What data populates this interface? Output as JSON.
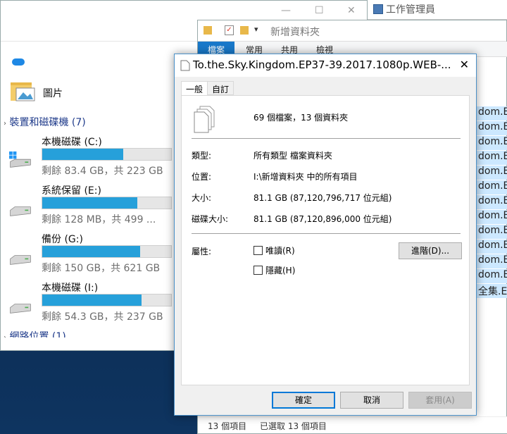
{
  "left_window": {
    "controls": [
      "—",
      "☐",
      "✕"
    ],
    "pictures_label": "圖片",
    "section_devices": "裝置和磁碟機 (7)",
    "drives": [
      {
        "name": "本機磁碟 (C:)",
        "free": "剩餘 83.4 GB，共 223 GB",
        "used_fraction": 0.63,
        "icon": "windows-drive-icon"
      },
      {
        "name": "系統保留 (E:)",
        "free": "剩餘 128 MB，共 499 ...",
        "used_fraction": 0.74,
        "icon": "drive-icon"
      },
      {
        "name": "備份 (G:)",
        "free": "剩餘 150 GB，共 621 GB",
        "used_fraction": 0.76,
        "icon": "drive-icon"
      },
      {
        "name": "本機磁碟 (I:)",
        "free": "剩餘 54.3 GB，共 237 GB",
        "used_fraction": 0.77,
        "icon": "drive-icon"
      }
    ],
    "section_network": "網路位置 (1)"
  },
  "right_window": {
    "title": "新增資料夾",
    "ribbon_tabs": [
      "檔案",
      "常用",
      "共用",
      "檢視"
    ],
    "list_items": [
      "dom.EP",
      "dom.EP",
      "dom.EP",
      "dom.EP",
      "dom.EP",
      "dom.EP",
      "dom.EP",
      "dom.EP",
      "dom.EP",
      "dom.EP",
      "dom.EP",
      "dom.EP",
      "全集.EP"
    ],
    "status_count": "13 個項目",
    "status_selected": "已選取 13 個項目"
  },
  "task_manager": {
    "title": "工作管理員"
  },
  "dialog": {
    "title": "To.the.Sky.Kingdom.EP37-39.2017.1080p.WEB-...",
    "close": "✕",
    "tabs": [
      "一般",
      "自訂"
    ],
    "summary": "69 個檔案，13 個資料夾",
    "rows": [
      {
        "label": "類型:",
        "value": "所有類型 檔案資料夾"
      },
      {
        "label": "位置:",
        "value": "I:\\新增資料夾 中的所有項目"
      },
      {
        "label": "大小:",
        "value": "81.1 GB (87,120,796,717 位元組)"
      },
      {
        "label": "磁碟大小:",
        "value": "81.1 GB (87,120,896,000 位元組)"
      }
    ],
    "attributes_label": "屬性:",
    "readonly_label": "唯讀(R)",
    "hidden_label": "隱藏(H)",
    "advanced_button": "進階(D)...",
    "ok_button": "確定",
    "cancel_button": "取消",
    "apply_button": "套用(A)"
  }
}
